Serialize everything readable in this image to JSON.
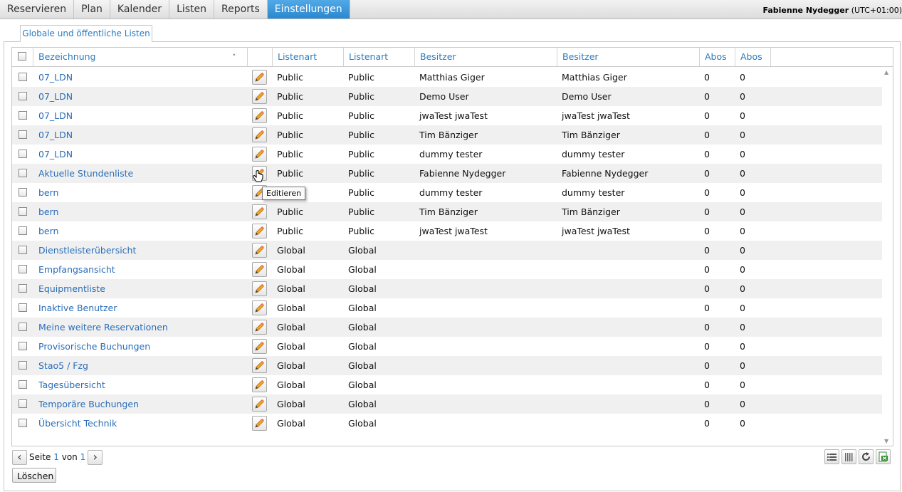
{
  "nav": {
    "tabs": [
      {
        "label": "Reservieren"
      },
      {
        "label": "Plan"
      },
      {
        "label": "Kalender"
      },
      {
        "label": "Listen"
      },
      {
        "label": "Reports"
      },
      {
        "label": "Einstellungen",
        "active": true
      }
    ],
    "user_name": "Fabienne Nydegger",
    "timezone": "(UTC+01:00)"
  },
  "subtab": {
    "label": "Globale und öffentliche Listen"
  },
  "table": {
    "columns": [
      "Bezeichnung",
      "Listenart",
      "Listenart",
      "Besitzer",
      "Besitzer",
      "Abos",
      "Abos"
    ],
    "rows": [
      {
        "name": "07_LDN",
        "type1": "Public",
        "type2": "Public",
        "owner1": "Matthias Giger",
        "owner2": "Matthias Giger",
        "abos1": "0",
        "abos2": "0"
      },
      {
        "name": "07_LDN",
        "type1": "Public",
        "type2": "Public",
        "owner1": "Demo User",
        "owner2": "Demo User",
        "abos1": "0",
        "abos2": "0"
      },
      {
        "name": "07_LDN",
        "type1": "Public",
        "type2": "Public",
        "owner1": "jwaTest jwaTest",
        "owner2": "jwaTest jwaTest",
        "abos1": "0",
        "abos2": "0"
      },
      {
        "name": "07_LDN",
        "type1": "Public",
        "type2": "Public",
        "owner1": "Tim Bänziger",
        "owner2": "Tim Bänziger",
        "abos1": "0",
        "abos2": "0"
      },
      {
        "name": "07_LDN",
        "type1": "Public",
        "type2": "Public",
        "owner1": "dummy tester",
        "owner2": "dummy tester",
        "abos1": "0",
        "abos2": "0"
      },
      {
        "name": "Aktuelle Stundenliste",
        "type1": "Public",
        "type2": "Public",
        "owner1": "Fabienne Nydegger",
        "owner2": "Fabienne Nydegger",
        "abos1": "0",
        "abos2": "0"
      },
      {
        "name": "bern",
        "type1": "",
        "type2": "Public",
        "owner1": "dummy tester",
        "owner2": "dummy tester",
        "abos1": "0",
        "abos2": "0"
      },
      {
        "name": "bern",
        "type1": "Public",
        "type2": "Public",
        "owner1": "Tim Bänziger",
        "owner2": "Tim Bänziger",
        "abos1": "0",
        "abos2": "0"
      },
      {
        "name": "bern",
        "type1": "Public",
        "type2": "Public",
        "owner1": "jwaTest jwaTest",
        "owner2": "jwaTest jwaTest",
        "abos1": "0",
        "abos2": "0"
      },
      {
        "name": "Dienstleisterübersicht",
        "type1": "Global",
        "type2": "Global",
        "owner1": "",
        "owner2": "",
        "abos1": "0",
        "abos2": "0"
      },
      {
        "name": "Empfangsansicht",
        "type1": "Global",
        "type2": "Global",
        "owner1": "",
        "owner2": "",
        "abos1": "0",
        "abos2": "0"
      },
      {
        "name": "Equipmentliste",
        "type1": "Global",
        "type2": "Global",
        "owner1": "",
        "owner2": "",
        "abos1": "0",
        "abos2": "0"
      },
      {
        "name": "Inaktive Benutzer",
        "type1": "Global",
        "type2": "Global",
        "owner1": "",
        "owner2": "",
        "abos1": "0",
        "abos2": "0"
      },
      {
        "name": "Meine weitere Reservationen",
        "type1": "Global",
        "type2": "Global",
        "owner1": "",
        "owner2": "",
        "abos1": "0",
        "abos2": "0"
      },
      {
        "name": "Provisorische Buchungen",
        "type1": "Global",
        "type2": "Global",
        "owner1": "",
        "owner2": "",
        "abos1": "0",
        "abos2": "0"
      },
      {
        "name": "Stao5 / Fzg",
        "type1": "Global",
        "type2": "Global",
        "owner1": "",
        "owner2": "",
        "abos1": "0",
        "abos2": "0"
      },
      {
        "name": "Tagesübersicht",
        "type1": "Global",
        "type2": "Global",
        "owner1": "",
        "owner2": "",
        "abos1": "0",
        "abos2": "0"
      },
      {
        "name": "Temporäre Buchungen",
        "type1": "Global",
        "type2": "Global",
        "owner1": "",
        "owner2": "",
        "abos1": "0",
        "abos2": "0"
      },
      {
        "name": "Übersicht Technik",
        "type1": "Global",
        "type2": "Global",
        "owner1": "",
        "owner2": "",
        "abos1": "0",
        "abos2": "0"
      }
    ]
  },
  "tooltip": {
    "text": "Editieren"
  },
  "pager": {
    "page_label": "Seite",
    "page": "1",
    "of_label": "von",
    "total": "1"
  },
  "buttons": {
    "delete_label": "Löschen"
  },
  "icons": {
    "edit": "pencil-icon",
    "prev": "chevron-left-icon",
    "next": "chevron-right-icon",
    "list": "list-view-icon",
    "columns": "columns-icon",
    "refresh": "refresh-icon",
    "export": "excel-export-icon"
  },
  "colors": {
    "accent": "#2a7bbf",
    "active_tab": "#3a97da",
    "row_alt": "#f0f0f0"
  }
}
